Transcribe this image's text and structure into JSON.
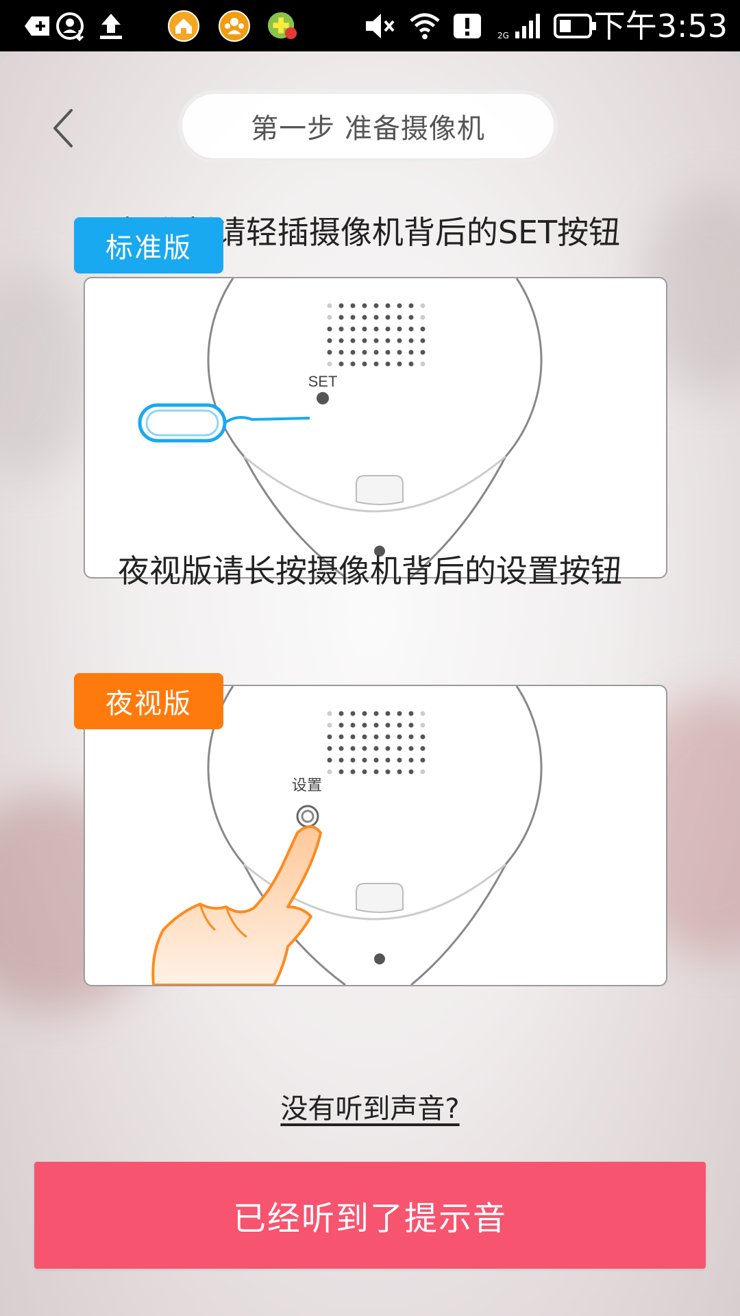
{
  "status_bar": {
    "time": "下午3:53",
    "network": "2G",
    "icons": [
      "add-icon",
      "contact-sync-icon",
      "upload-icon",
      "home-app-icon",
      "people-app-icon",
      "plus-app-icon",
      "mute-icon",
      "wifi-icon",
      "alert-icon",
      "signal-icon",
      "battery-icon"
    ]
  },
  "header": {
    "title": "第一步 准备摄像机",
    "back_icon": "chevron-left-icon"
  },
  "standard": {
    "instruction": "标准版请轻插摄像机背后的SET按钮",
    "badge": "标准版",
    "badge_color": "#19a9f1",
    "button_label": "SET"
  },
  "night": {
    "instruction": "夜视版请长按摄像机背后的设置按钮",
    "badge": "夜视版",
    "badge_color": "#ff7a0d",
    "button_label": "设置"
  },
  "help_link": "没有听到声音?",
  "confirm_button": "已经听到了提示音",
  "colors": {
    "accent": "#f6546f"
  }
}
